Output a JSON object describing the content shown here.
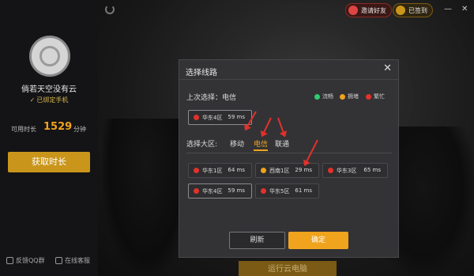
{
  "sidebar": {
    "username": "倘若天空没有云",
    "bound_text": "已绑定手机",
    "time_label": "可用时长",
    "time_value": "1529",
    "time_unit": "分钟",
    "get_time_label": "获取时长",
    "feedback_label": "反馈QQ群",
    "support_label": "在线客服"
  },
  "topbar": {
    "invite_label": "邀请好友",
    "signin_label": "已签到"
  },
  "dialog": {
    "title": "选择线路",
    "last_label": "上次选择：电信",
    "legend": [
      {
        "label": "流畅",
        "color": "#2ecc71"
      },
      {
        "label": "拥堵",
        "color": "#f0a31c"
      },
      {
        "label": "繁忙",
        "color": "#e0322b"
      }
    ],
    "last_server": {
      "name": "华东4区",
      "ms": "59 ms",
      "color": "#e0322b"
    },
    "region_label": "选择大区:",
    "tabs": [
      "移动",
      "电信",
      "联通"
    ],
    "active_tab": "电信",
    "servers": [
      {
        "name": "华东1区",
        "ms": "64 ms",
        "color": "#e0322b"
      },
      {
        "name": "西南1区",
        "ms": "29 ms",
        "color": "#f0a31c"
      },
      {
        "name": "华东3区",
        "ms": "65 ms",
        "color": "#e0322b"
      },
      {
        "name": "华东4区",
        "ms": "59 ms",
        "color": "#e0322b"
      },
      {
        "name": "华东5区",
        "ms": "61 ms",
        "color": "#e0322b"
      }
    ],
    "refresh_label": "刷新",
    "ok_label": "确定"
  },
  "bottom": {
    "cloud_label": "运行云电脑"
  }
}
